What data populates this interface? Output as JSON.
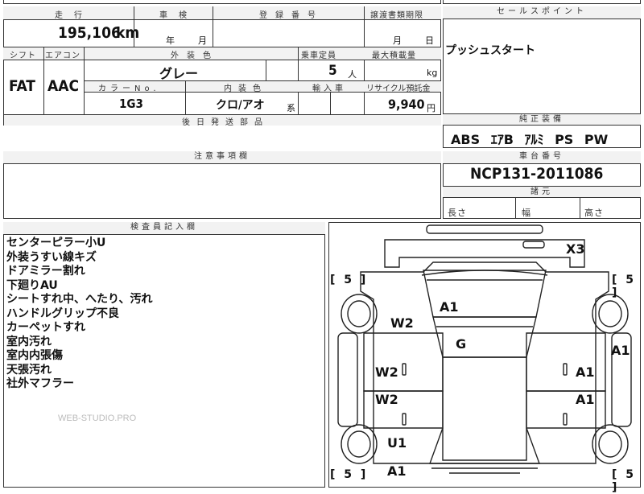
{
  "top_row": {
    "mileage_label": "走行",
    "inspection_label": "車検",
    "registration_label": "登録番号",
    "transfer_label": "譲渡書類期限",
    "selling_points_label": "セールスポイント",
    "mileage_value": "195,106",
    "mileage_unit": "km",
    "year_unit": "年",
    "month_unit": "月",
    "transfer_month_unit": "月",
    "transfer_day_unit": "日",
    "selling_point": "プッシュスタート"
  },
  "spec_row": {
    "shift_label": "シフト",
    "aircon_label": "エアコン",
    "exterior_color_label": "外装色",
    "capacity_label": "乗車定員",
    "max_load_label": "最大積載量",
    "shift_value": "FAT",
    "aircon_value": "AAC",
    "exterior_color_value": "グレー",
    "capacity_value": "5",
    "capacity_unit": "人",
    "load_unit": "kg",
    "color_no_label": "カラーNo.",
    "interior_color_label": "内装色",
    "import_label": "輸入車",
    "recycle_label": "リサイクル預託金",
    "color_no_value": "1G3",
    "interior_color_value": "クロ/アオ",
    "interior_suffix": "系",
    "recycle_value": "9,940",
    "recycle_unit": "円"
  },
  "later_parts_label": "後日発送部品",
  "standard_equipment": {
    "label": "純正装備",
    "items": [
      "ABS",
      "ｴｱB",
      "ｱﾙﾐ",
      "PS",
      "PW"
    ]
  },
  "caution_label": "注意事項欄",
  "chassis": {
    "label": "車台番号",
    "value": "NCP131-2011086",
    "dimensions_label": "諸元",
    "length_label": "長さ",
    "width_label": "幅",
    "height_label": "高さ"
  },
  "inspector": {
    "label": "検査員記入欄",
    "notes": [
      "センターピラー小U",
      "外装うすい線キズ",
      "ドアミラー割れ",
      "下廻りAU",
      "シートすれ中、へたり、汚れ",
      "ハンドルグリップ不良",
      "カーペットすれ",
      "室内汚れ",
      "室内内張傷",
      "天張汚れ",
      "社外マフラー"
    ],
    "watermark": "WEB-STUDIO.PRO"
  },
  "diagram": {
    "marks": {
      "x3": "X3",
      "a1_hood": "A1",
      "w2_front_left": "W2",
      "g_glass": "G",
      "a1_right_fender": "A1",
      "w2_front_door": "W2",
      "a1_front_door_right": "A1",
      "w2_rear_door": "W2",
      "a1_rear_door_right": "A1",
      "u1_rear_left": "U1",
      "a1_rear": "A1"
    },
    "tires": {
      "front_left": "5",
      "front_right": "5",
      "rear_left": "5",
      "rear_right": "5"
    }
  }
}
